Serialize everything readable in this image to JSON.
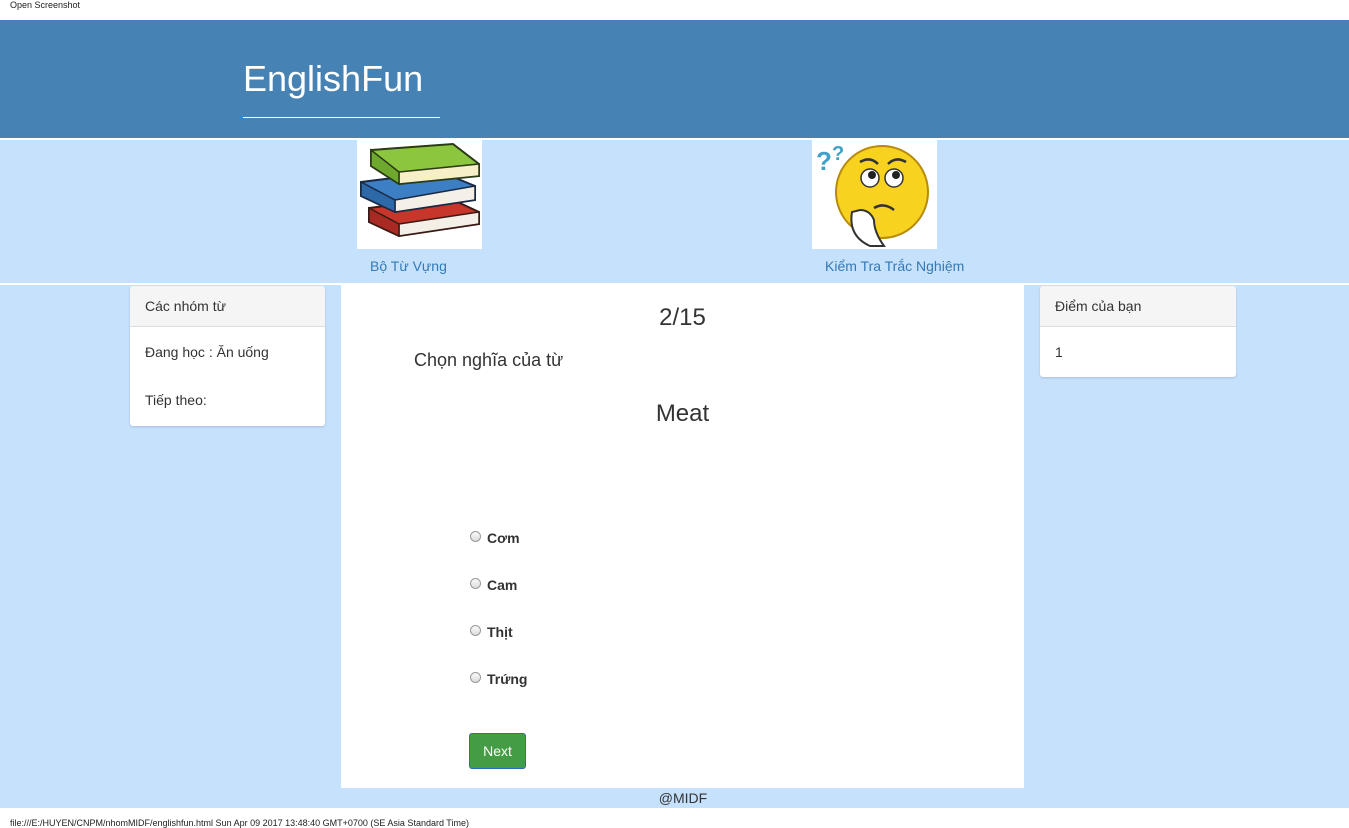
{
  "print": {
    "header": "Open Screenshot",
    "footer": "file:///E:/HUYEN/CNPM/nhomMIDF/englishfun.html Sun Apr 09 2017 13:48:40 GMT+0700 (SE Asia Standard Time)"
  },
  "brand": "EnglishFun",
  "nav": {
    "vocab_label": "Bộ Từ Vựng",
    "quiz_label": "Kiểm Tra Trắc Nghiệm"
  },
  "left_panel": {
    "heading": "Các nhóm từ",
    "learning": "Đang học : Ăn uống",
    "next": "Tiếp theo:"
  },
  "quiz": {
    "counter": "2/15",
    "instruction": "Chọn nghĩa của từ",
    "word": "Meat",
    "options": [
      "Cơm",
      "Cam",
      "Thịt",
      "Trứng"
    ],
    "next_label": "Next"
  },
  "right_panel": {
    "heading": "Điểm của bạn",
    "score": "1"
  },
  "footer": "@MIDF",
  "colors": {
    "header_bg": "#4682b4",
    "band_bg": "#c6e1fc",
    "link": "#337ab7",
    "next_button": "#449d44"
  }
}
